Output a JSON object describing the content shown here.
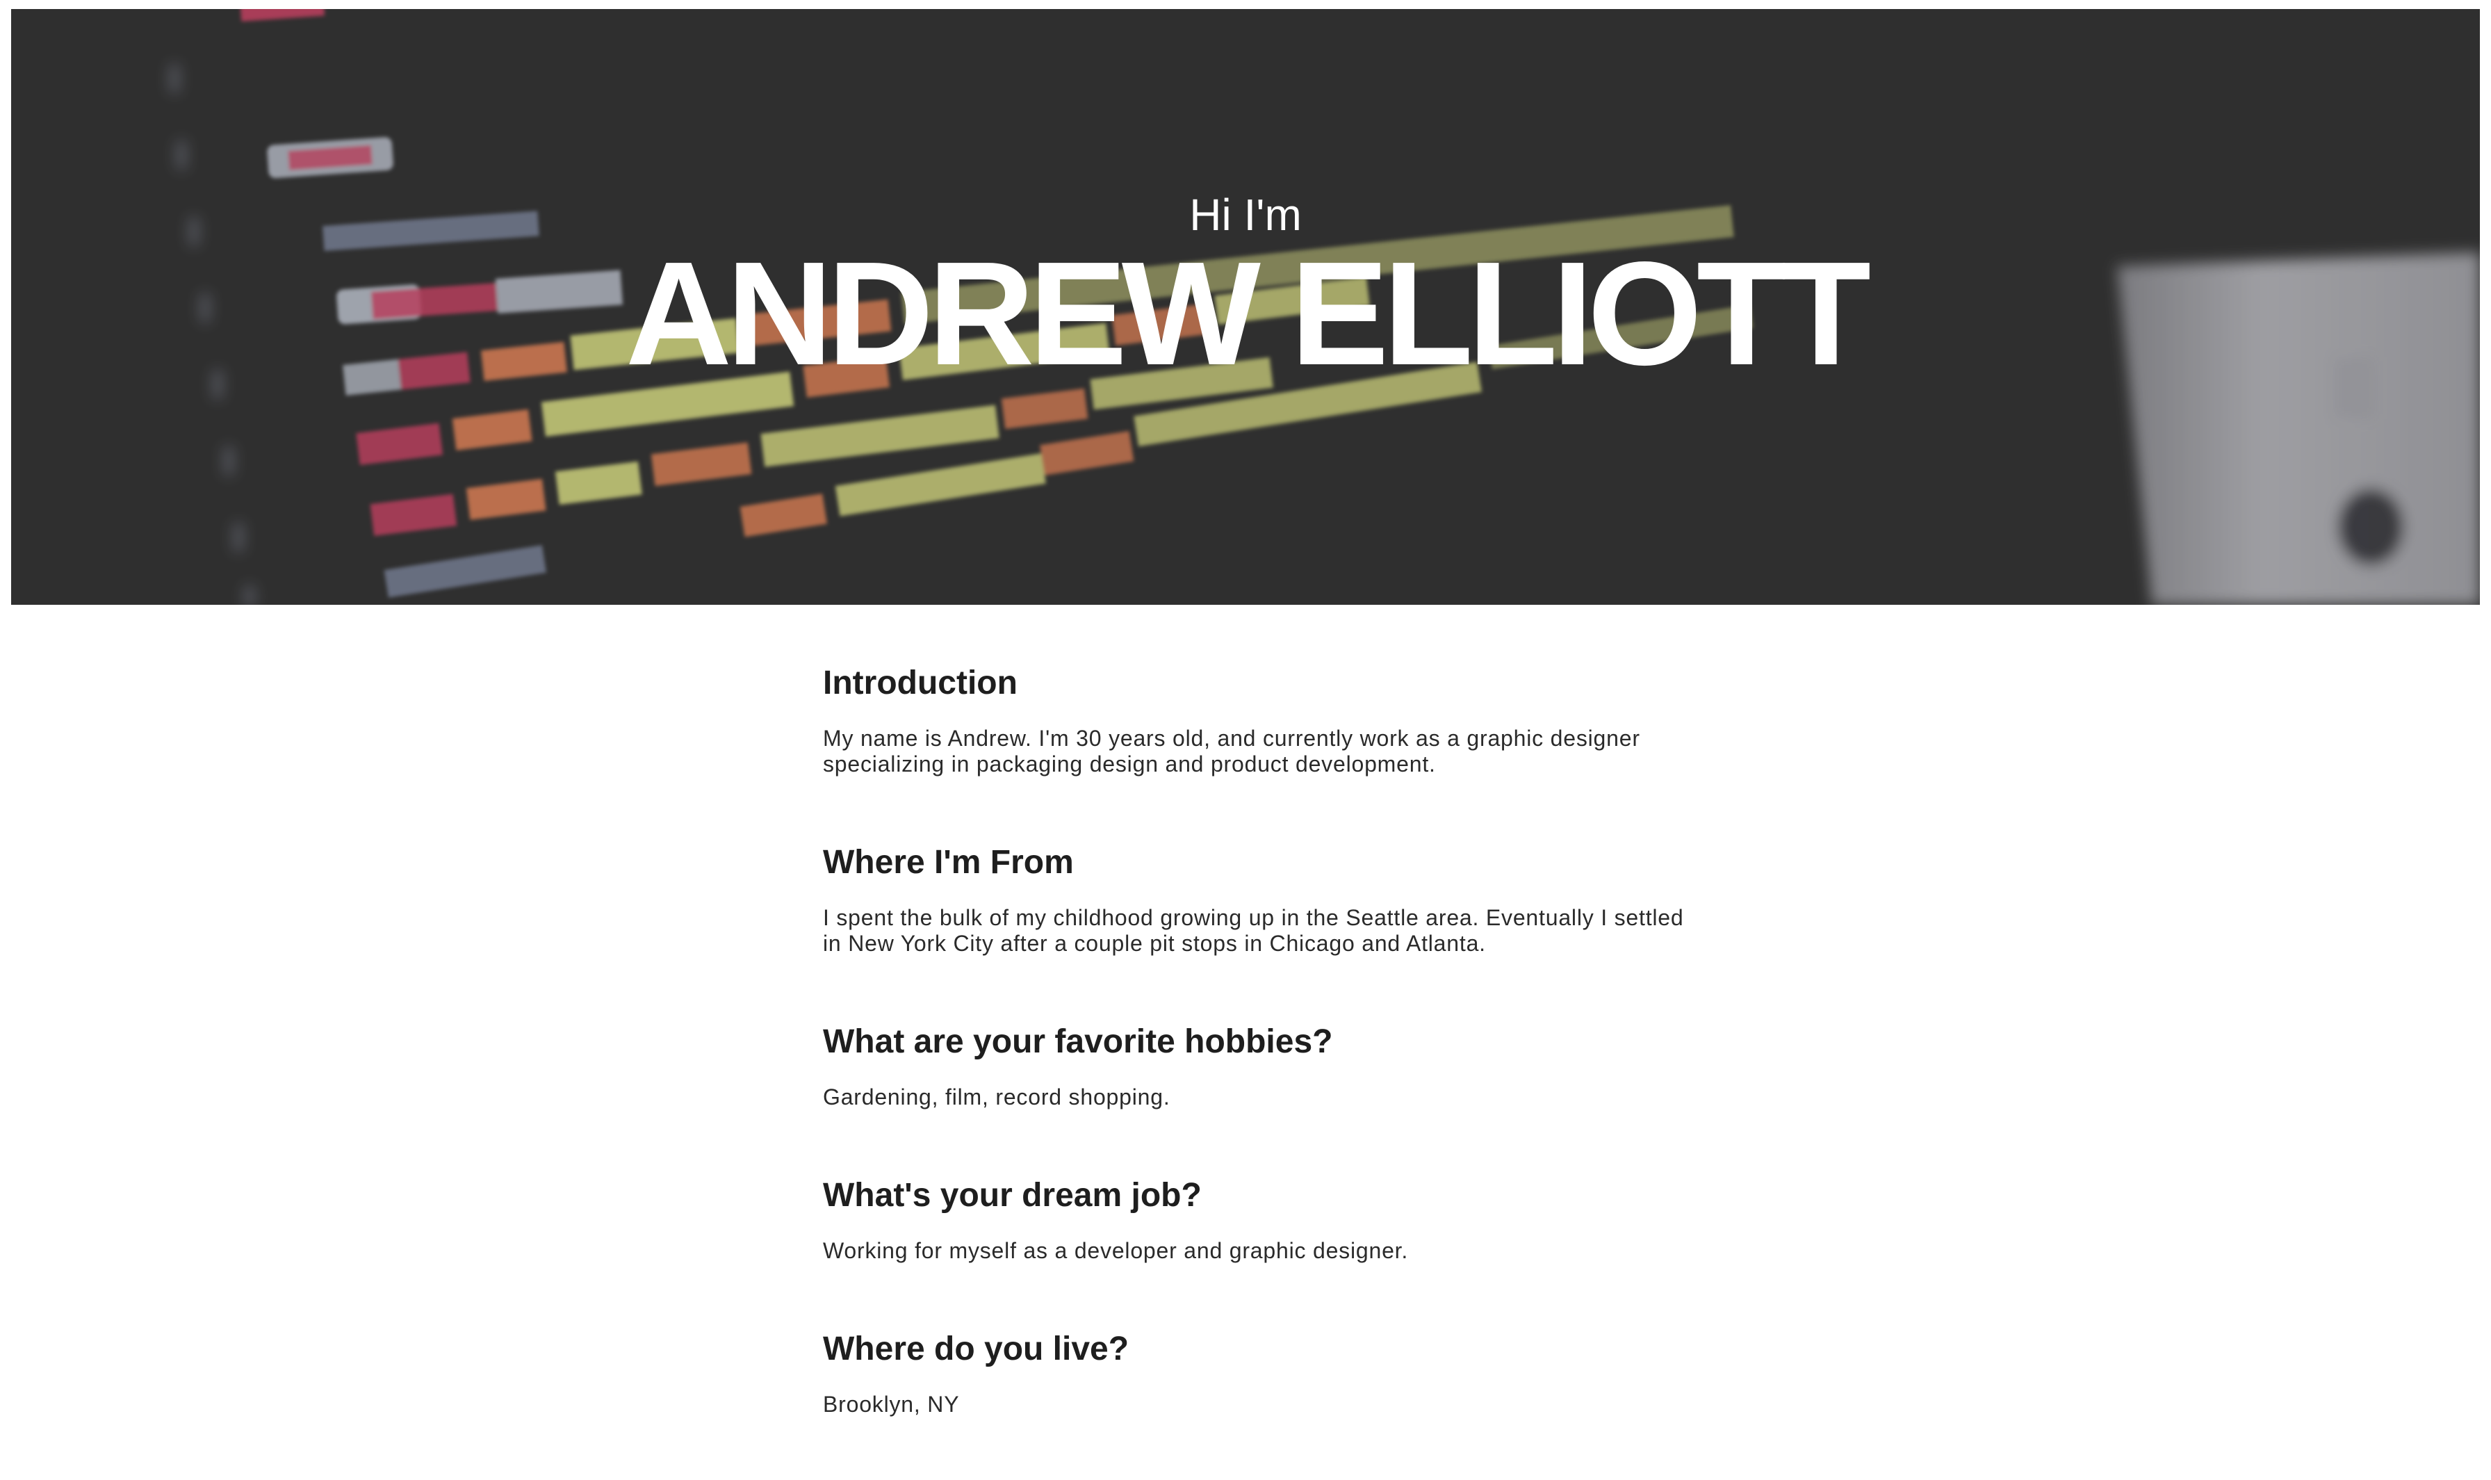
{
  "hero": {
    "greeting": "Hi I'm",
    "name": "ANDREW ELLIOTT",
    "background_image": "blurred-code-editor-photo"
  },
  "sections": [
    {
      "heading": "Introduction",
      "body": "My name is Andrew. I'm 30 years old, and currently work as a graphic designer specializing in packaging design and product development."
    },
    {
      "heading": "Where I'm From",
      "body": "I spent the bulk of my childhood growing up in the Seattle area. Eventually I settled in New York City after a couple pit stops in Chicago and Atlanta."
    },
    {
      "heading": "What are your favorite hobbies?",
      "body": "Gardening, film, record shopping."
    },
    {
      "heading": "What's your dream job?",
      "body": "Working for myself as a developer and graphic designer."
    },
    {
      "heading": "Where do you live?",
      "body": "Brooklyn, NY"
    }
  ],
  "colors": {
    "hero_background": "#333333",
    "hero_text": "#ffffff",
    "heading_text": "#1e1e1e",
    "body_text": "#2a2a2a",
    "page_background": "#ffffff"
  }
}
